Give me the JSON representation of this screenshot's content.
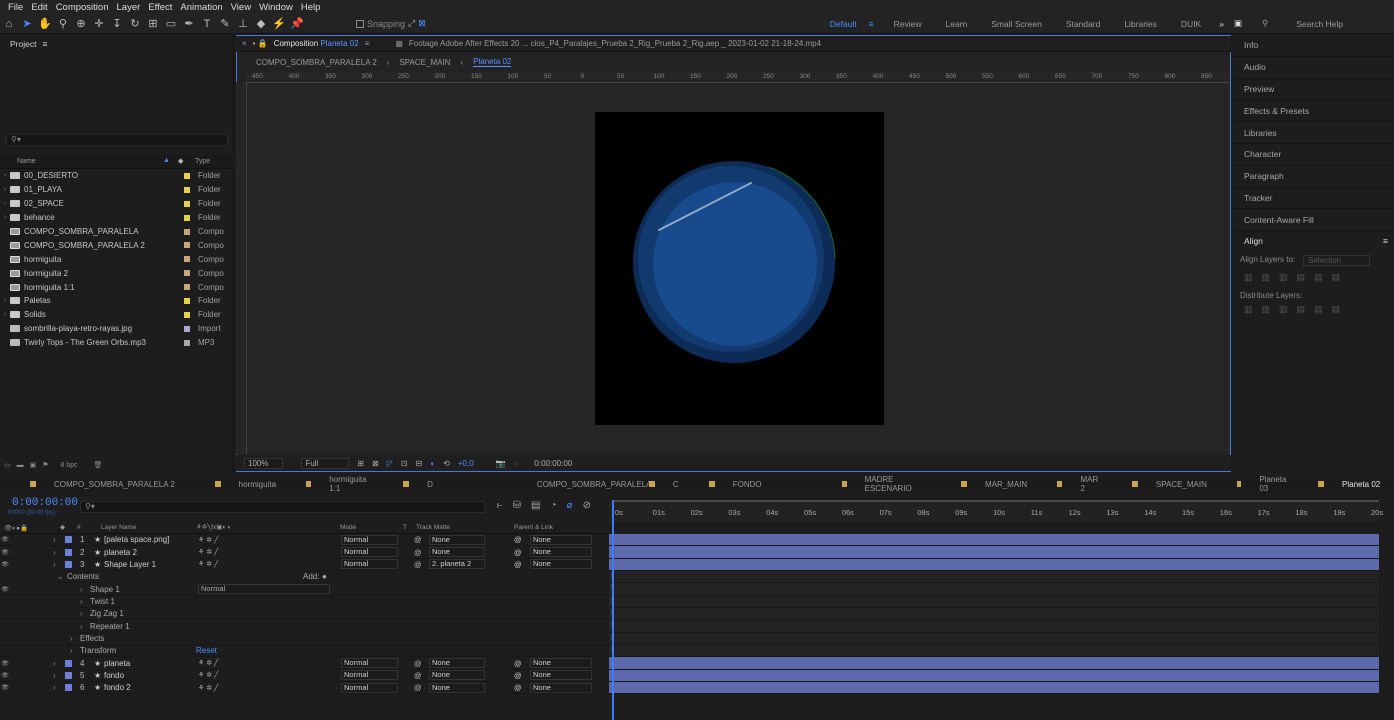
{
  "menu": [
    "File",
    "Edit",
    "Composition",
    "Layer",
    "Effect",
    "Animation",
    "View",
    "Window",
    "Help"
  ],
  "toolbar": {
    "snapping": "Snapping"
  },
  "workspaces": [
    "Default",
    "Review",
    "Learn",
    "Small Screen",
    "Standard",
    "Libraries",
    "DUIK"
  ],
  "search_help": "Search Help",
  "project": {
    "title": "Project",
    "col_name": "Name",
    "col_type": "Type",
    "items": [
      {
        "name": "00_DESIERTO",
        "type": "Folder",
        "kind": "folder",
        "color": "#e8d04a"
      },
      {
        "name": "01_PLAYA",
        "type": "Folder",
        "kind": "folder",
        "color": "#e8d04a"
      },
      {
        "name": "02_SPACE",
        "type": "Folder",
        "kind": "folder",
        "color": "#e8d04a"
      },
      {
        "name": "behance",
        "type": "Folder",
        "kind": "folder",
        "color": "#e8d04a"
      },
      {
        "name": "COMPO_SOMBRA_PARALELA",
        "type": "Compo",
        "kind": "comp",
        "color": "#c7a77a"
      },
      {
        "name": "COMPO_SOMBRA_PARALELA 2",
        "type": "Compo",
        "kind": "comp",
        "color": "#c7a77a"
      },
      {
        "name": "hormiguita",
        "type": "Compo",
        "kind": "comp",
        "color": "#c7a77a"
      },
      {
        "name": "hormiguita 2",
        "type": "Compo",
        "kind": "comp",
        "color": "#c7a77a"
      },
      {
        "name": "hormiguita 1:1",
        "type": "Compo",
        "kind": "comp",
        "color": "#c7a77a"
      },
      {
        "name": "Paletas",
        "type": "Folder",
        "kind": "folder",
        "color": "#e8d04a"
      },
      {
        "name": "Solids",
        "type": "Folder",
        "kind": "folder",
        "color": "#e8d04a"
      },
      {
        "name": "sombrilla-playa-retro-rayas.jpg",
        "type": "Import",
        "kind": "file",
        "color": "#a9a9d9"
      },
      {
        "name": "Twirly Tops - The Green Orbs.mp3",
        "type": "MP3",
        "kind": "file",
        "color": "#a9a9a9"
      }
    ],
    "bpc": "8 bpc"
  },
  "viewer": {
    "tab_label": "Composition",
    "tab_comp": "Planeta 02",
    "footage": "Footage Adobe After Effects 20 ... cios_P4_Paralajes_Prueba 2_Rig_Prueba 2_Rig.aep _ 2023-01-02 21-18-24.mp4",
    "breadcrumbs": [
      "COMPO_SOMBRA_PARALELA 2",
      "SPACE_MAIN",
      "Planeta 02"
    ],
    "zoom": "100%",
    "resolution": "Full",
    "exposure": "+0,0",
    "timecode": "0:00:00:00",
    "ruler": [
      "450",
      "400",
      "350",
      "300",
      "250",
      "200",
      "150",
      "100",
      "50",
      "0",
      "50",
      "100",
      "150",
      "200",
      "250",
      "300",
      "350",
      "400",
      "450",
      "500",
      "550",
      "600",
      "650",
      "700",
      "750",
      "800",
      "850"
    ]
  },
  "right_panel": {
    "items": [
      "Info",
      "Audio",
      "Preview",
      "Effects & Presets",
      "Libraries",
      "Character",
      "Paragraph",
      "Tracker",
      "Content-Aware Fill"
    ],
    "align": "Align",
    "align_to_label": "Align Layers to:",
    "align_to_value": "Selection",
    "distribute": "Distribute Layers:"
  },
  "timeline": {
    "tabs": [
      "COMPO_SOMBRA_PARALELA 2",
      "hormiguita",
      "hormiguita 1:1",
      "D",
      "COMPO_SOMBRA_PARALELA",
      "C",
      "FONDO",
      "MADRE ESCENARIO",
      "MAR_MAIN",
      "MAR 2",
      "SPACE_MAIN",
      "Planeta 03",
      "Planeta 02"
    ],
    "timecode": "0:00:00:00",
    "fps": "00000 (30.00 fps)",
    "headers": {
      "layer_name": "Layer Name",
      "mode": "Mode",
      "t": "T",
      "track_matte": "Track Matte",
      "parent": "Parent & Link",
      "num": "#"
    },
    "ruler": [
      "0s",
      "01s",
      "02s",
      "03s",
      "04s",
      "05s",
      "06s",
      "07s",
      "08s",
      "09s",
      "10s",
      "11s",
      "12s",
      "13s",
      "14s",
      "15s",
      "16s",
      "17s",
      "18s",
      "19s",
      "20s"
    ],
    "layers": [
      {
        "num": "1",
        "name": "[paleta space.png]",
        "mode": "Normal",
        "matte": "None",
        "parent": "None"
      },
      {
        "num": "2",
        "name": "planeta 2",
        "mode": "Normal",
        "matte": "None",
        "parent": "None"
      },
      {
        "num": "3",
        "name": "Shape Layer 1",
        "mode": "Normal",
        "matte": "2. planeta 2",
        "parent": "None"
      }
    ],
    "sub": {
      "contents": "Contents",
      "add": "Add:",
      "shape1": "Shape 1",
      "shape1_mode": "Normal",
      "twist": "Twist 1",
      "zigzag": "Zig Zag 1",
      "repeater": "Repeater 1",
      "effects": "Effects",
      "transform": "Transform",
      "reset": "Reset"
    },
    "layers2": [
      {
        "num": "4",
        "name": "planeta",
        "mode": "Normal",
        "matte": "None",
        "parent": "None"
      },
      {
        "num": "5",
        "name": "fondo",
        "mode": "Normal",
        "matte": "None",
        "parent": "None"
      },
      {
        "num": "6",
        "name": "fondo 2",
        "mode": "Normal",
        "matte": "None",
        "parent": "None"
      }
    ]
  }
}
